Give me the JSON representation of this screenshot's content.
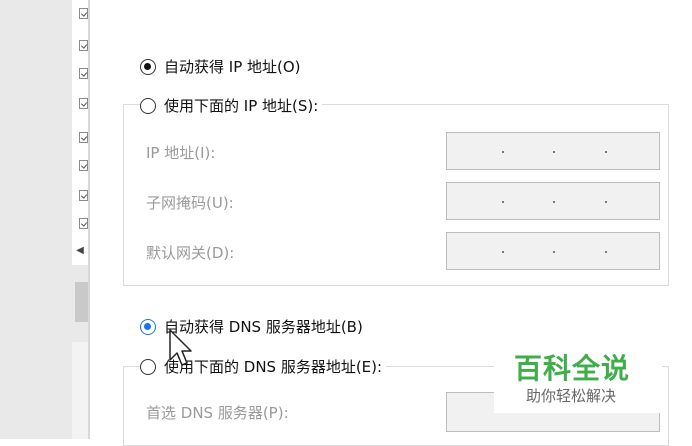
{
  "ip_section": {
    "auto_label": "自动获得 IP 地址(O)",
    "manual_label": "使用下面的 IP 地址(S):",
    "fields": [
      {
        "label": "IP 地址(I):"
      },
      {
        "label": "子网掩码(U):"
      },
      {
        "label": "默认网关(D):"
      }
    ]
  },
  "dns_section": {
    "auto_label": "自动获得 DNS 服务器地址(B)",
    "manual_label": "使用下面的 DNS 服务器地址(E):",
    "preferred_label": "首选 DNS 服务器(P):"
  },
  "watermark": {
    "title": "百科全说",
    "subtitle": "助你轻松解决"
  },
  "colors": {
    "accent": "#1a73e8",
    "watermark_green": "#3fae4a"
  }
}
